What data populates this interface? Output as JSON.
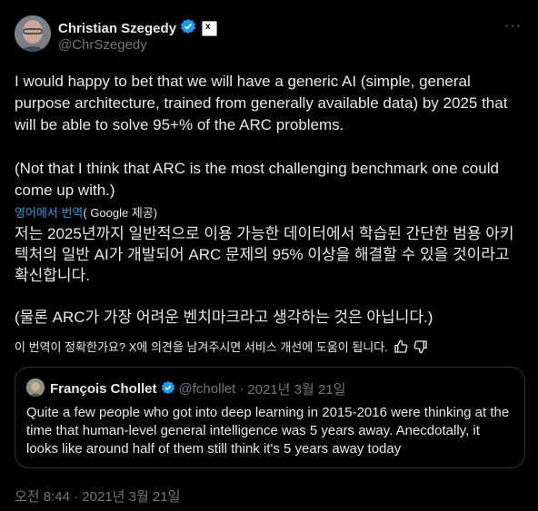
{
  "author": {
    "name": "Christian Szegedy",
    "handle": "@ChrSzegedy",
    "affiliate_badge": "x"
  },
  "more_label": "···",
  "tweet": {
    "paragraph1": "I would happy to bet that we will have a generic AI (simple, general purpose architecture, trained from generally available data) by 2025 that will be able to solve 95+% of the ARC problems.",
    "paragraph2": "(Not that I think that ARC is the most challenging benchmark one could come up with.)"
  },
  "translation": {
    "link": "영어에서 번역",
    "provider": "( Google 제공)",
    "paragraph1": "저는 2025년까지 일반적으로 이용 가능한 데이터에서 학습된 간단한 범용 아키텍처의 일반 AI가 개발되어 ARC 문제의 95% 이상을 해결할 수 있을 것이라고 확신합니다.",
    "paragraph2": "(물론 ARC가 가장 어려운 벤치마크라고 생각하는 것은 아닙니다.)",
    "feedback": "이 번역이 정확한가요? X에 의견을 남겨주시면 서비스 개선에 도움이 됩니다."
  },
  "quote": {
    "name": "François Chollet",
    "handle": "@fchollet",
    "separator": "·",
    "date": "2021년 3월 21일",
    "text": "Quite a few people who got into deep learning in 2015-2016 were thinking at the time that human-level general intelligence was 5 years away. Anecdotally, it looks like around half of them still think it's 5 years away today"
  },
  "timestamp": "오전 8:44 · 2021년 3월 21일",
  "colors": {
    "background": "#000000",
    "text": "#e7e9ea",
    "muted": "#71767b",
    "accent": "#1d9bf0",
    "border": "#2f3336"
  }
}
